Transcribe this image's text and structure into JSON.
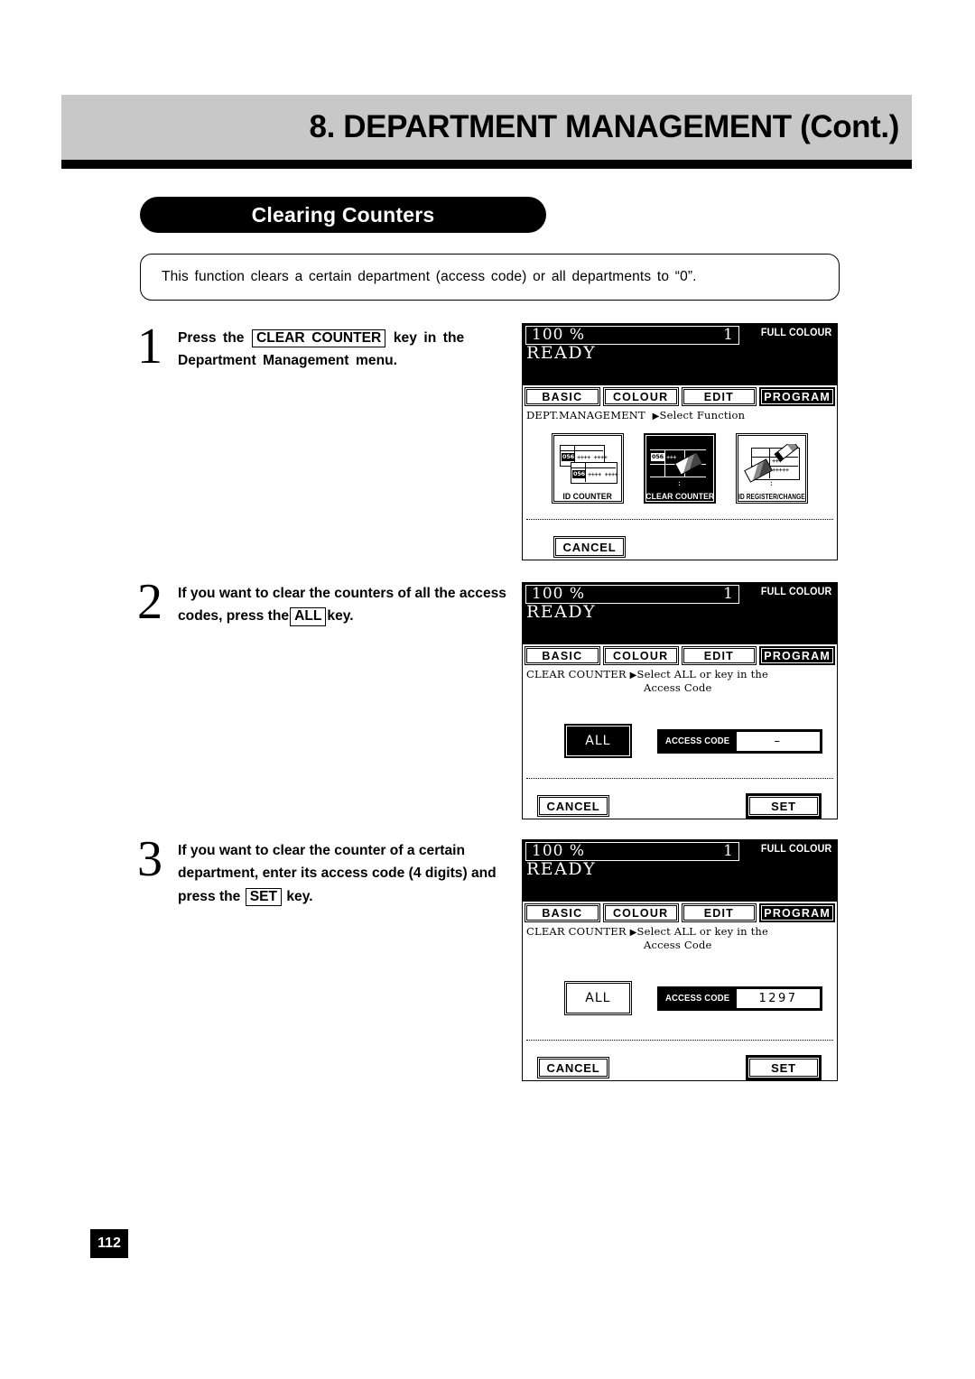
{
  "page": {
    "chapter_title": "8. DEPARTMENT MANAGEMENT",
    "chapter_title_suffix": "(Cont.)",
    "section_title": "Clearing Counters",
    "intro": "This function clears a certain department (access code) or all departments to “0”.",
    "page_number": "112"
  },
  "steps": [
    {
      "number": "1",
      "text_before": "Press the",
      "keycap": "CLEAR COUNTER",
      "text_after": "key in the Department Management menu."
    },
    {
      "number": "2",
      "text_before": "If you want to clear the counters of all the access codes, press the",
      "keycap": "ALL",
      "text_after": "key."
    },
    {
      "number": "3",
      "text_before": "If you want to clear the counter of a certain department, enter its access code (4 digits) and press the",
      "keycap": "SET",
      "text_after": "key."
    }
  ],
  "lcd_common": {
    "ratio": "100 %",
    "copies": "1",
    "colour_mode": "FULL COLOUR",
    "status": "READY",
    "tabs": [
      {
        "label": "BASIC",
        "active": false
      },
      {
        "label": "COLOUR",
        "active": false
      },
      {
        "label": "EDIT",
        "active": false
      },
      {
        "label": "PROGRAM",
        "active": true
      }
    ],
    "cancel_label": "CANCEL",
    "set_label": "SET",
    "all_label": "ALL",
    "access_code_label": "ACCESS CODE"
  },
  "lcd_panels": [
    {
      "id": "panel-1",
      "message_line1": "DEPT.MANAGEMENT",
      "message_arrow": "▶",
      "message_line2": "Select Function",
      "functions": [
        {
          "label": "ID COUNTER",
          "selected": false,
          "icon": "id-counter-icon"
        },
        {
          "label": "CLEAR COUNTER",
          "selected": true,
          "icon": "clear-counter-icon"
        },
        {
          "label": "ID REGISTER/CHANGE",
          "selected": false,
          "icon": "id-register-change-icon"
        }
      ]
    },
    {
      "id": "panel-2",
      "message_line1": "CLEAR COUNTER",
      "message_arrow": "▶",
      "message_line2": "Select ALL or key in the",
      "message_line3": "Access Code",
      "all_selected": true,
      "access_code_value": "–"
    },
    {
      "id": "panel-3",
      "message_line1": "CLEAR COUNTER",
      "message_arrow": "▶",
      "message_line2": "Select ALL or key in the",
      "message_line3": "Access Code",
      "all_selected": false,
      "access_code_value": "1297"
    }
  ],
  "colors": {
    "header_band": "#c8c8c8",
    "ink": "#000000",
    "paper": "#ffffff"
  }
}
